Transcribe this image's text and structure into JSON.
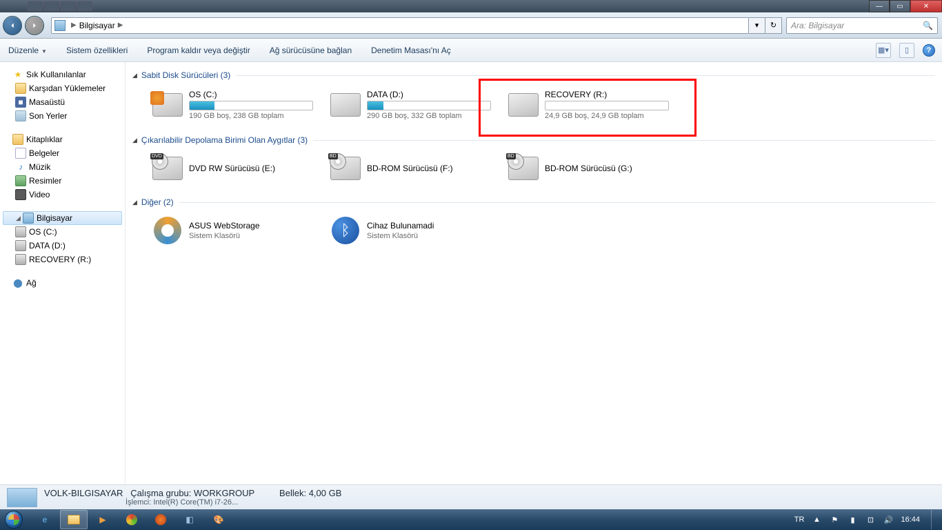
{
  "breadcrumb": {
    "root": "Bilgisayar"
  },
  "search": {
    "placeholder": "Ara: Bilgisayar"
  },
  "toolbar": {
    "organize": "Düzenle",
    "sysprops": "Sistem özellikleri",
    "uninstall": "Program kaldır veya değiştir",
    "mapdrive": "Ağ sürücüsüne bağlan",
    "ctrlpanel": "Denetim Masası'nı Aç"
  },
  "sidebar": {
    "favorites": "Sık Kullanılanlar",
    "downloads": "Karşıdan Yüklemeler",
    "desktop": "Masaüstü",
    "recent": "Son Yerler",
    "libraries": "Kitaplıklar",
    "documents": "Belgeler",
    "music": "Müzik",
    "pictures": "Resimler",
    "videos": "Video",
    "computer": "Bilgisayar",
    "drive_c": "OS (C:)",
    "drive_d": "DATA (D:)",
    "drive_r": "RECOVERY (R:)",
    "network": "Ağ"
  },
  "groups": {
    "hdd": {
      "title": "Sabit Disk Sürücüleri (3)"
    },
    "removable": {
      "title": "Çıkarılabilir Depolama Birimi Olan Aygıtlar (3)"
    },
    "other": {
      "title": "Diğer (2)"
    }
  },
  "drives": {
    "c": {
      "name": "OS (C:)",
      "sub": "190 GB boş, 238 GB toplam",
      "fill": 20
    },
    "d": {
      "name": "DATA (D:)",
      "sub": "290 GB boş, 332 GB toplam",
      "fill": 13
    },
    "r": {
      "name": "RECOVERY (R:)",
      "sub": "24,9 GB boş, 24,9 GB toplam",
      "fill": 0
    }
  },
  "removable": {
    "e": {
      "name": "DVD RW Sürücüsü (E:)"
    },
    "f": {
      "name": "BD-ROM Sürücüsü (F:)"
    },
    "g": {
      "name": "BD-ROM Sürücüsü (G:)"
    }
  },
  "other": {
    "asus": {
      "name": "ASUS WebStorage",
      "sub": "Sistem Klasörü"
    },
    "bt": {
      "name": "Cihaz Bulunamadi",
      "sub": "Sistem Klasörü"
    }
  },
  "status": {
    "pcname": "VOLK-BILGISAYAR",
    "wg_key": "Çalışma grubu:",
    "wg_val": "WORKGROUP",
    "cpu_key": "İşlemci:",
    "cpu_val": "Intel(R) Core(TM) i7-26...",
    "mem_key": "Bellek:",
    "mem_val": "4,00 GB"
  },
  "tray": {
    "lang": "TR",
    "time": "16:44"
  },
  "badges": {
    "dvd": "DVD",
    "bd": "BD"
  }
}
